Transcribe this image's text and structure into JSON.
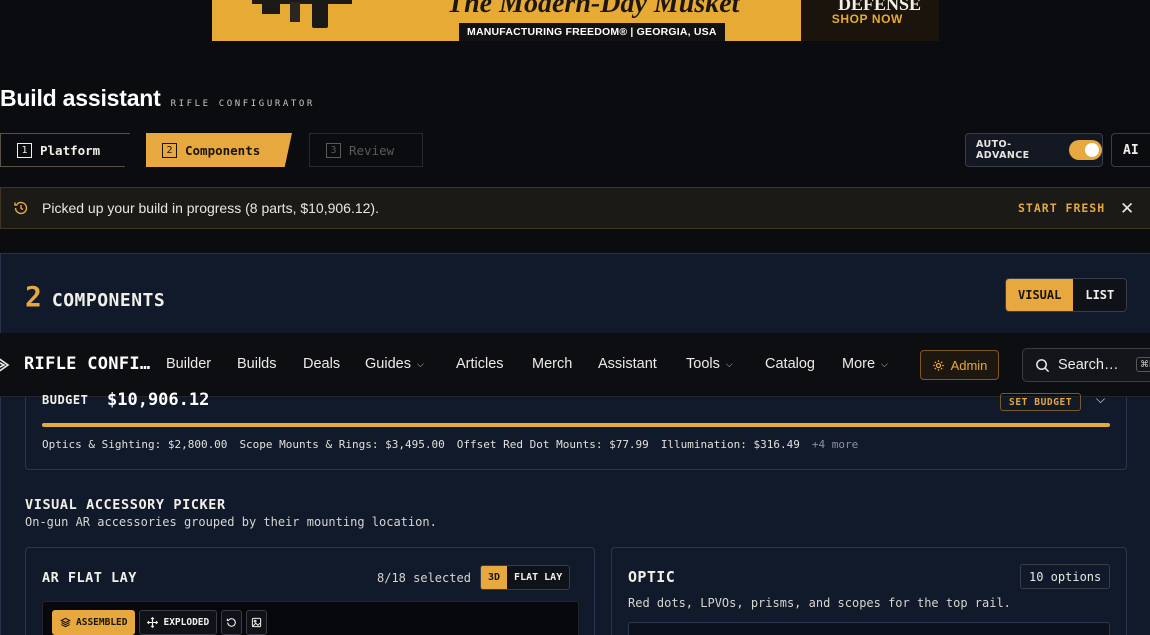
{
  "banner": {
    "tagline": "The Modern-Day Musket",
    "subline": "MANUFACTURING FREEDOM® | GEORGIA, USA",
    "brand": "DEFENSE",
    "cta": "SHOP NOW"
  },
  "page": {
    "title": "Build assistant",
    "subtitle": "RIFLE CONFIGURATOR"
  },
  "steps": [
    {
      "num": "1",
      "label": "Platform",
      "state": "done"
    },
    {
      "num": "2",
      "label": "Components",
      "state": "active"
    },
    {
      "num": "3",
      "label": "Review",
      "state": "disabled"
    }
  ],
  "auto_advance": {
    "label": "AUTO-ADVANCE",
    "on": true
  },
  "ai_button": "AI",
  "resume": {
    "message": "Picked up your build in progress (8 parts, $10,906.12).",
    "start_fresh": "START FRESH",
    "close": "✕"
  },
  "section": {
    "count": "2",
    "title": "COMPONENTS",
    "views": [
      "VISUAL",
      "LIST"
    ],
    "active_view": "VISUAL"
  },
  "nav": {
    "brand": "RIFLE CONFI…",
    "items": [
      "Builder",
      "Builds",
      "Deals",
      "Guides",
      "Articles",
      "Merch",
      "Assistant",
      "Tools",
      "Catalog",
      "More"
    ],
    "admin": "Admin",
    "search_placeholder": "Search…",
    "search_kbd": "⌘K"
  },
  "budget": {
    "label": "BUDGET",
    "amount": "$10,906.12",
    "set_budget": "SET BUDGET",
    "progress": 1.0,
    "categories": [
      "Optics & Sighting: $2,800.00",
      "Scope Mounts & Rings: $3,495.00",
      "Offset Red Dot Mounts: $77.99",
      "Illumination: $316.49"
    ],
    "more": "+4 more"
  },
  "picker": {
    "title": "VISUAL ACCESSORY PICKER",
    "subtitle": "On-gun AR accessories grouped by their mounting location."
  },
  "flat_lay": {
    "title": "AR FLAT LAY",
    "selected": "8/18 selected",
    "modes": [
      "3D",
      "FLAT LAY"
    ],
    "active_mode": "3D",
    "tools": [
      "ASSEMBLED",
      "EXPLODED"
    ]
  },
  "optic": {
    "title": "OPTIC",
    "badge": "10 options",
    "description": "Red dots, LPVOs, prisms, and scopes for the top rail."
  },
  "colors": {
    "accent": "#e6a83f",
    "panel": "#111a2a",
    "background": "#0b0c0f"
  }
}
